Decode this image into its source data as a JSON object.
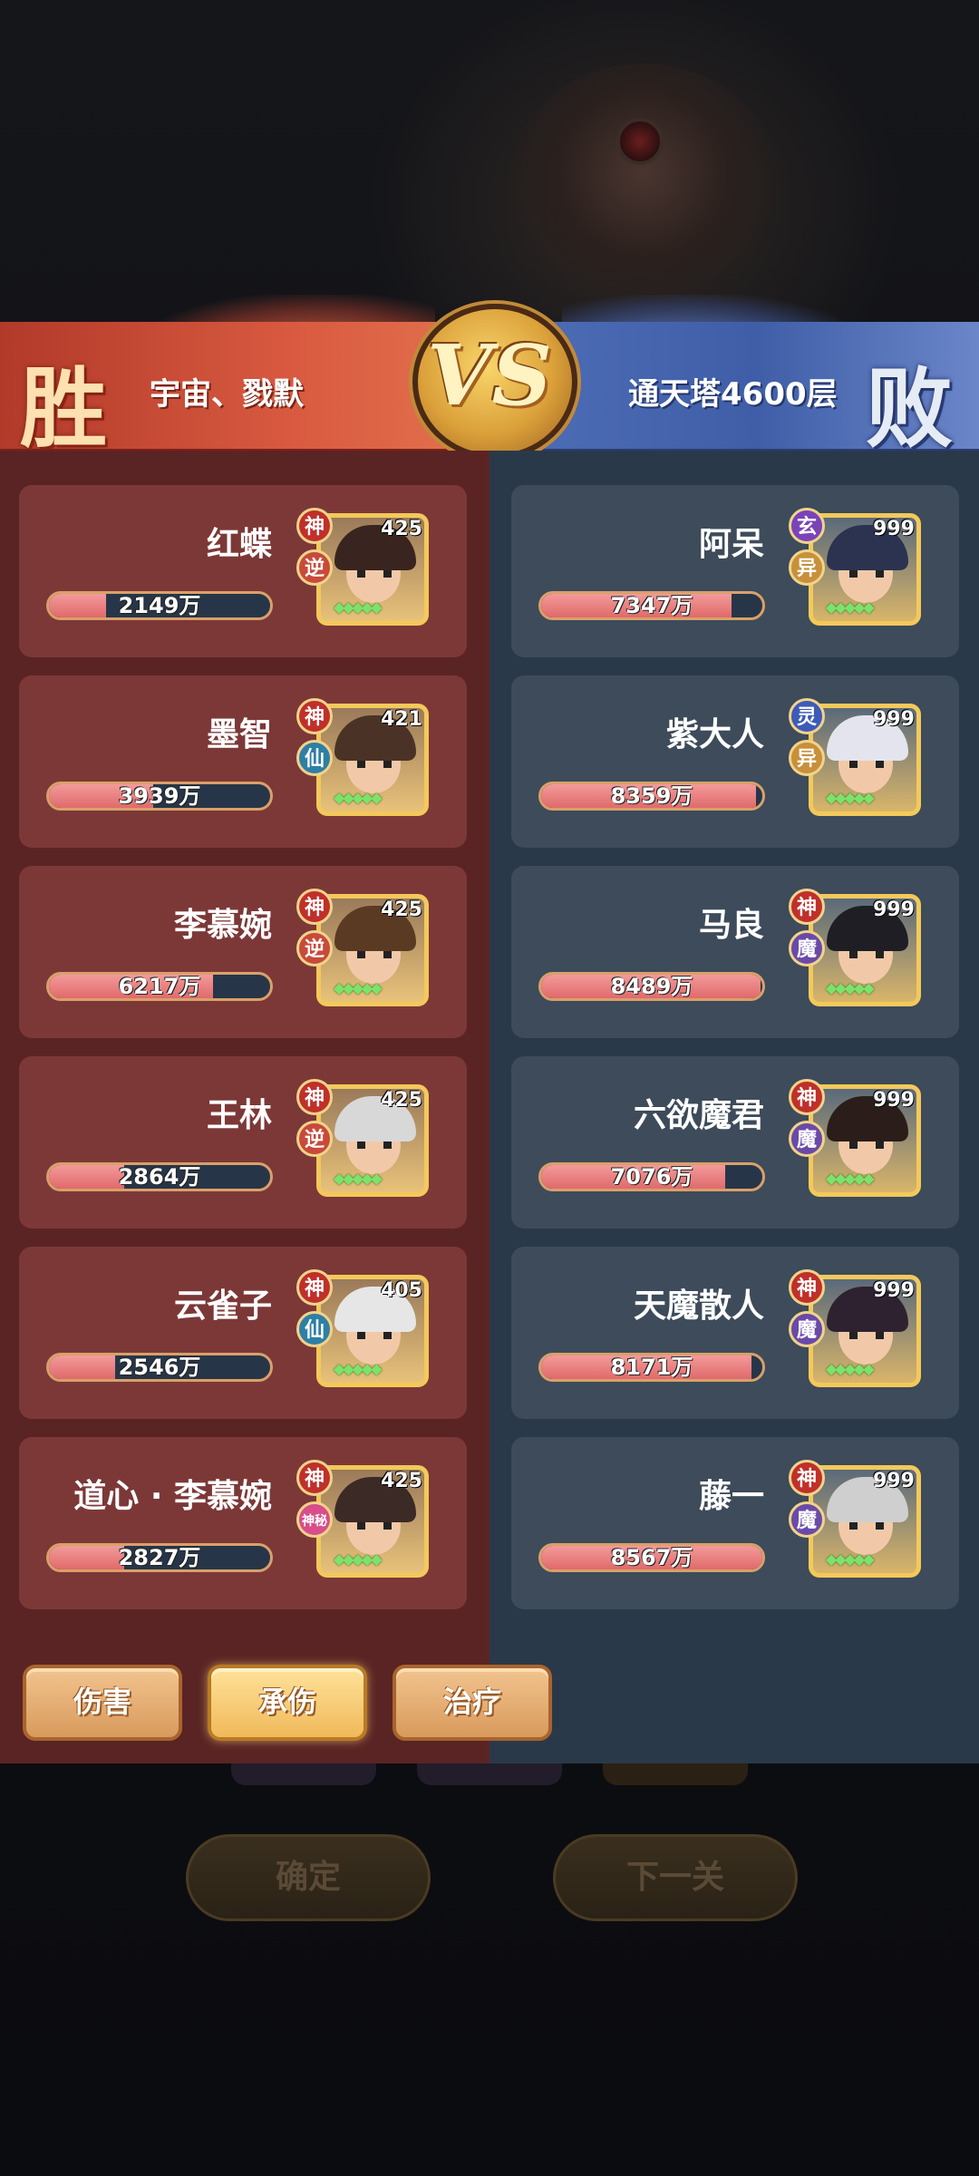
{
  "header": {
    "left_result": "胜",
    "right_result": "败",
    "left_team": "宇宙、戮默",
    "right_team": "通天塔4600层",
    "vs": "VS"
  },
  "left_heroes": [
    {
      "name": "红蝶",
      "level": "425",
      "badge1": "神",
      "badge2": "逆",
      "value_text": "2149万",
      "fill": 0.26,
      "hair": "#3a2420"
    },
    {
      "name": "墨智",
      "level": "421",
      "badge1": "神",
      "badge2": "仙",
      "value_text": "3939万",
      "fill": 0.47,
      "hair": "#4a3326"
    },
    {
      "name": "李慕婉",
      "level": "425",
      "badge1": "神",
      "badge2": "逆",
      "value_text": "6217万",
      "fill": 0.74,
      "hair": "#5b3a24"
    },
    {
      "name": "王林",
      "level": "425",
      "badge1": "神",
      "badge2": "逆",
      "value_text": "2864万",
      "fill": 0.34,
      "hair": "#d8d8d8"
    },
    {
      "name": "云雀子",
      "level": "405",
      "badge1": "神",
      "badge2": "仙",
      "value_text": "2546万",
      "fill": 0.3,
      "hair": "#e6e6e6"
    },
    {
      "name": "道心 · 李慕婉",
      "level": "425",
      "badge1": "神",
      "badge2": "神秘",
      "value_text": "2827万",
      "fill": 0.34,
      "hair": "#3b2a26"
    }
  ],
  "right_heroes": [
    {
      "name": "阿呆",
      "level": "999",
      "badge1": "玄",
      "badge2": "异",
      "value_text": "7347万",
      "fill": 0.86,
      "hair": "#2b3350"
    },
    {
      "name": "紫大人",
      "level": "999",
      "badge1": "灵",
      "badge2": "异",
      "value_text": "8359万",
      "fill": 0.97,
      "hair": "#e4e4ee"
    },
    {
      "name": "马良",
      "level": "999",
      "badge1": "神",
      "badge2": "魔",
      "value_text": "8489万",
      "fill": 0.99,
      "hair": "#1e1e24"
    },
    {
      "name": "六欲魔君",
      "level": "999",
      "badge1": "神",
      "badge2": "魔",
      "value_text": "7076万",
      "fill": 0.83,
      "hair": "#2a1d1a"
    },
    {
      "name": "天魔散人",
      "level": "999",
      "badge1": "神",
      "badge2": "魔",
      "value_text": "8171万",
      "fill": 0.95,
      "hair": "#2e2230"
    },
    {
      "name": "藤一",
      "level": "999",
      "badge1": "神",
      "badge2": "魔",
      "value_text": "8567万",
      "fill": 1.0,
      "hair": "#cfcfcf"
    }
  ],
  "tabs": {
    "damage": "伤害",
    "taken": "承伤",
    "heal": "治疗",
    "active": "承伤"
  },
  "background_buttons": {
    "confirm": "确定",
    "next": "下一关"
  },
  "colors": {
    "win_red": "#b23a2a",
    "lose_blue": "#4f6fb8",
    "bar_fill": "#e06a6a",
    "gold_frame": "#f3c95a"
  }
}
